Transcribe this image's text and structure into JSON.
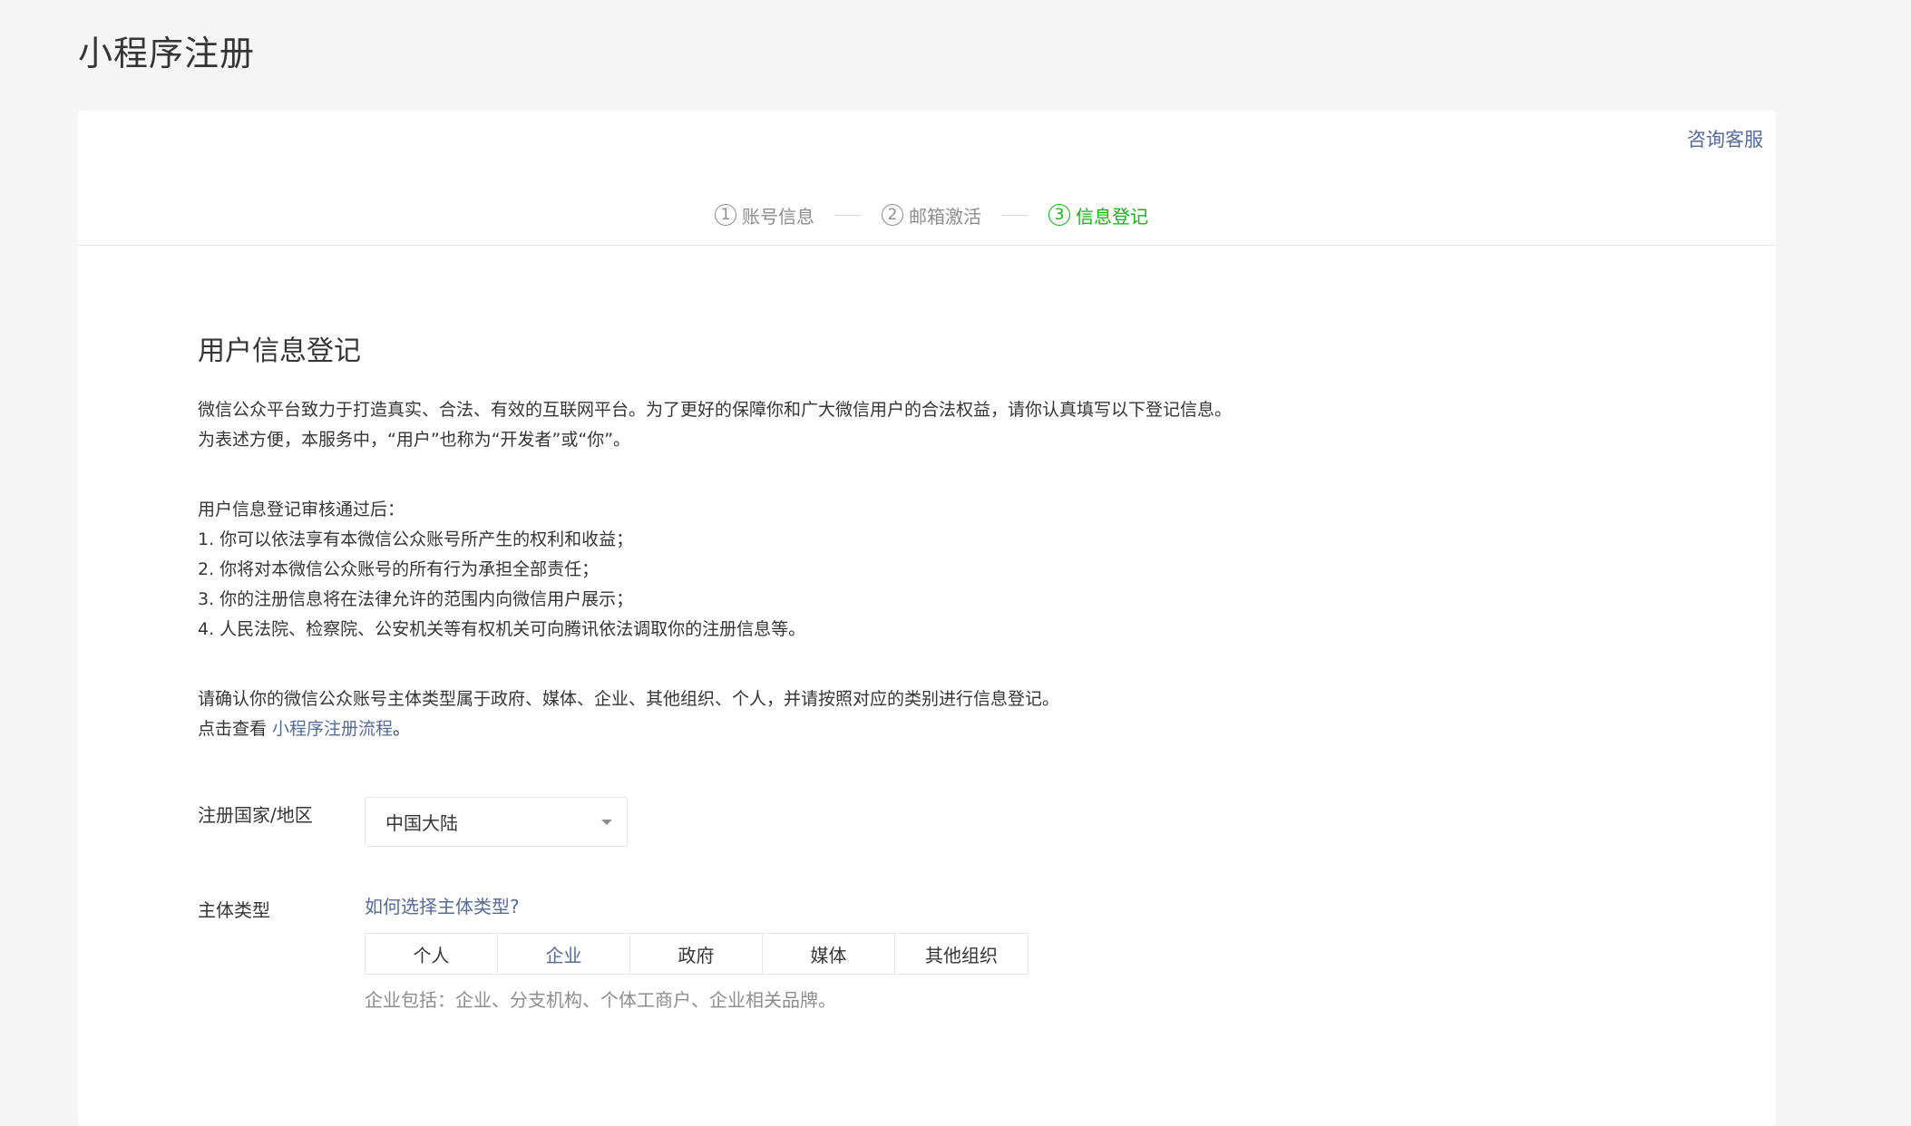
{
  "page": {
    "title": "小程序注册"
  },
  "header": {
    "help_link": "咨询客服"
  },
  "steps": [
    {
      "num": "1",
      "label": "账号信息",
      "state": "done"
    },
    {
      "num": "2",
      "label": "邮箱激活",
      "state": "done"
    },
    {
      "num": "3",
      "label": "信息登记",
      "state": "active"
    }
  ],
  "content": {
    "title": "用户信息登记",
    "intro_1": "微信公众平台致力于打造真实、合法、有效的互联网平台。为了更好的保障你和广大微信用户的合法权益，请你认真填写以下登记信息。",
    "intro_2": "为表述方便，本服务中，“用户”也称为“开发者”或“你”。",
    "after_title": "用户信息登记审核通过后：",
    "after_items": [
      "1. 你可以依法享有本微信公众账号所产生的权利和收益；",
      "2. 你将对本微信公众账号的所有行为承担全部责任；",
      "3. 你的注册信息将在法律允许的范围内向微信用户展示；",
      "4. 人民法院、检察院、公安机关等有权机关可向腾讯依法调取你的注册信息等。"
    ],
    "confirm_text": "请确认你的微信公众账号主体类型属于政府、媒体、企业、其他组织、个人，并请按照对应的类别进行信息登记。",
    "flow_prefix": "点击查看 ",
    "flow_link": "小程序注册流程",
    "flow_suffix": "。"
  },
  "form": {
    "country_label": "注册国家/地区",
    "country_value": "中国大陆",
    "type_label": "主体类型",
    "type_help": "如何选择主体类型?",
    "types": [
      "个人",
      "企业",
      "政府",
      "媒体",
      "其他组织"
    ],
    "selected_type": "企业",
    "type_hint": "企业包括：企业、分支机构、个体工商户、企业相关品牌。"
  },
  "colors": {
    "accent_green": "#1aad19",
    "link_blue": "#576b95",
    "muted": "#8d8d8d"
  }
}
